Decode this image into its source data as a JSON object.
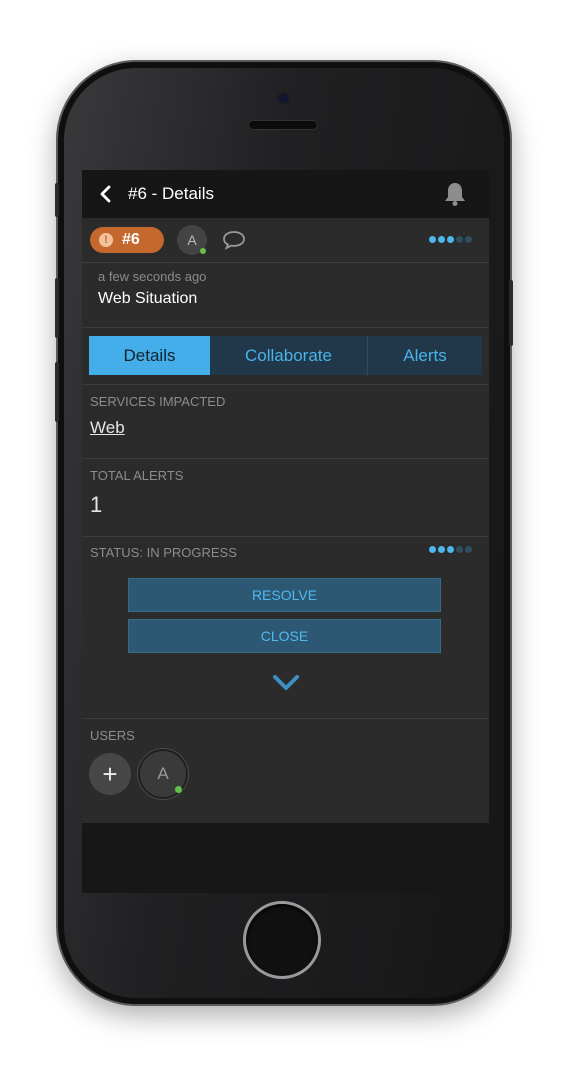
{
  "header": {
    "title": "#6 - Details"
  },
  "situation": {
    "badge_number": "#6",
    "badge_icon": "!",
    "avatar_initial": "A",
    "timestamp": "a few seconds ago",
    "name": "Web Situation"
  },
  "tabs": [
    {
      "label": "Details",
      "active": true
    },
    {
      "label": "Collaborate",
      "active": false
    },
    {
      "label": "Alerts",
      "active": false
    }
  ],
  "details": {
    "services_label": "SERVICES IMPACTED",
    "services_value": "Web",
    "total_alerts_label": "TOTAL ALERTS",
    "total_alerts_value": "1",
    "status_label": "STATUS: IN PROGRESS",
    "resolve_label": "RESOLVE",
    "close_label": "CLOSE"
  },
  "users": {
    "label": "USERS",
    "add_symbol": "+",
    "avatar_initial": "A"
  },
  "progress": {
    "filled_dots": 3,
    "total_dots": 5
  },
  "colors": {
    "accent": "#43aee9",
    "badge": "#c4682d",
    "online": "#62c24b",
    "button_bg": "#2c5873"
  },
  "icons": {
    "back": "chevron-left-icon",
    "bell": "bell-icon",
    "comment": "comment-icon",
    "expand": "chevron-down-icon",
    "add": "plus-icon"
  }
}
